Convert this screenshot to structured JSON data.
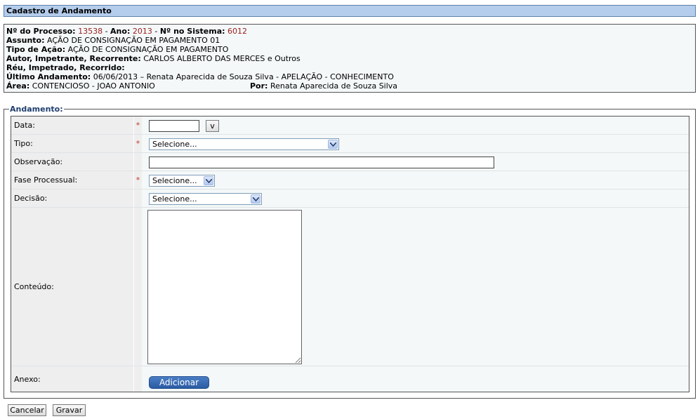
{
  "header": {
    "title": "Cadastro de Andamento"
  },
  "info": {
    "processo_label": "Nº do Processo:",
    "processo_value": "13538",
    "ano_label": "Ano:",
    "ano_value": "2013",
    "sistema_label": "Nº no Sistema:",
    "sistema_value": "6012",
    "assunto_label": "Assunto:",
    "assunto_value": "AÇÃO DE CONSIGNAÇÃO EM PAGAMENTO 01",
    "tipo_acao_label": "Tipo de Ação:",
    "tipo_acao_value": "AÇÃO DE CONSIGNAÇÃO EM PAGAMENTO",
    "autor_label": "Autor, Impetrante, Recorrente:",
    "autor_value": "CARLOS ALBERTO DAS MERCES e Outros",
    "reu_label": "Réu, Impetrado, Recorrido:",
    "ultimo_label": "Último Andamento:",
    "ultimo_value": "06/06/2013 – Renata Aparecida de Souza Silva - APELAÇÃO - CONHECIMENTO",
    "area_label": "Área:",
    "area_value": "CONTENCIOSO - JOAO ANTONIO",
    "por_label": "Por:",
    "por_value": "Renata Aparecida de Souza Silva"
  },
  "form": {
    "legend": "Andamento:",
    "required_mark": "*",
    "data_label": "Data:",
    "data_value": "",
    "date_button": "v",
    "tipo_label": "Tipo:",
    "tipo_selected": "Selecione...",
    "observacao_label": "Observação:",
    "observacao_value": "",
    "fase_label": "Fase Processual:",
    "fase_selected": "Selecione...",
    "decisao_label": "Decisão:",
    "decisao_selected": "Selecione...",
    "conteudo_label": "Conteúdo:",
    "conteudo_value": "",
    "anexo_label": "Anexo:",
    "adicionar_button": "Adicionar"
  },
  "actions": {
    "cancelar": "Cancelar",
    "gravar": "Gravar"
  },
  "colors": {
    "title_bg": "#b5cdec",
    "panel_bg": "#f4f8f8",
    "required": "#c0392b",
    "value_red": "#9b1c1c",
    "button_blue": "#2a5aa3"
  }
}
